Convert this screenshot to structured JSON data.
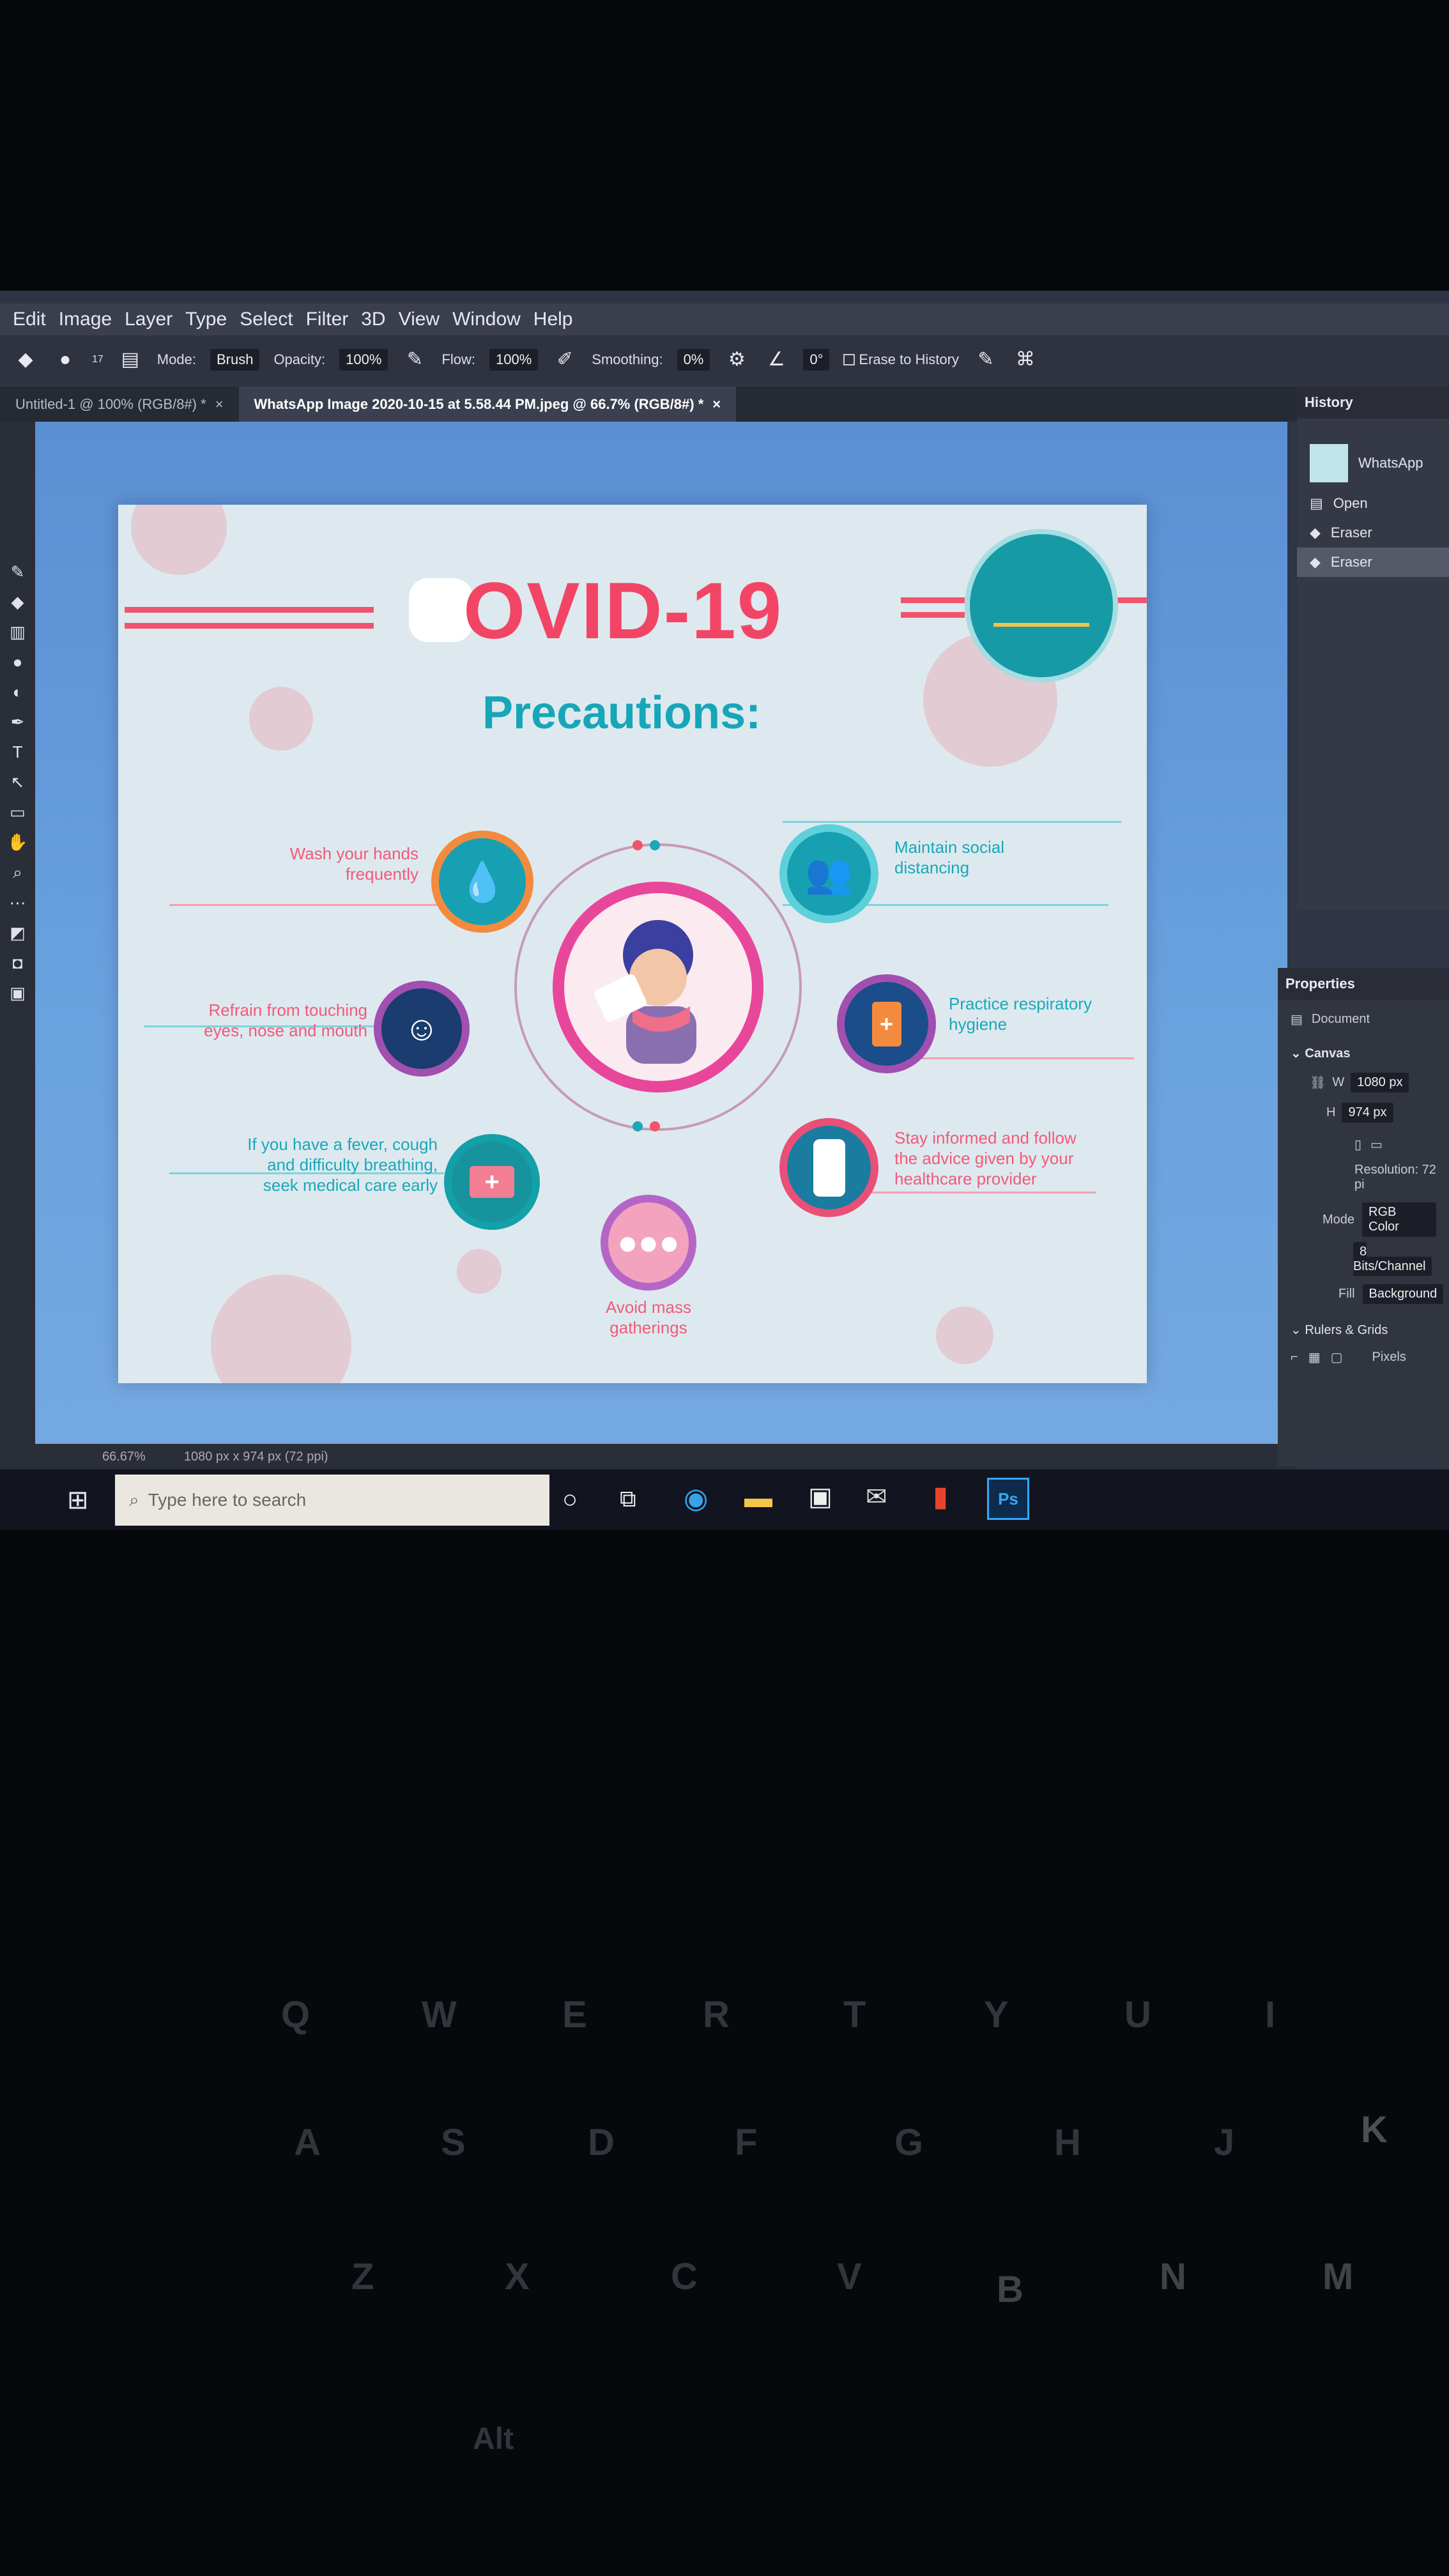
{
  "menu": [
    "Edit",
    "Image",
    "Layer",
    "Type",
    "Select",
    "Filter",
    "3D",
    "View",
    "Window",
    "Help"
  ],
  "options": {
    "mode_label": "Mode:",
    "mode_value": "Brush",
    "opacity_label": "Opacity:",
    "opacity_value": "100%",
    "flow_label": "Flow:",
    "flow_value": "100%",
    "smoothing_label": "Smoothing:",
    "smoothing_value": "0%",
    "angle_value": "0°",
    "erase_history": "Erase to History",
    "brush_size": "17"
  },
  "tabs": [
    {
      "label": "Untitled-1 @ 100% (RGB/8#) *"
    },
    {
      "label": "WhatsApp Image 2020-10-15 at 5.58.44 PM.jpeg @ 66.7% (RGB/8#) *"
    }
  ],
  "poster": {
    "title": "OVID-19",
    "subtitle": "Precautions:",
    "tips_left": [
      {
        "text": "Wash your hands\nfrequently"
      },
      {
        "text": "Refrain from touching\neyes, nose and mouth"
      },
      {
        "text": "If you have a fever, cough\nand difficulty breathing,\nseek medical care early"
      }
    ],
    "tips_right": [
      {
        "text": "Maintain social\ndistancing"
      },
      {
        "text": "Practice respiratory\nhygiene"
      },
      {
        "text": "Stay informed and follow\nthe advice given by your\nhealthcare provider"
      }
    ],
    "tip_bottom": "Avoid mass\ngatherings"
  },
  "history": {
    "title": "History",
    "snapshot": "WhatsApp",
    "items": [
      {
        "label": "Open"
      },
      {
        "label": "Eraser"
      },
      {
        "label": "Eraser"
      }
    ]
  },
  "properties": {
    "title": "Properties",
    "document": "Document",
    "canvas": "Canvas",
    "w_label": "W",
    "w_value": "1080 px",
    "h_label": "H",
    "h_value": "974 px",
    "resolution": "Resolution: 72 pi",
    "mode_label": "Mode",
    "mode_value": "RGB Color",
    "bits": "8 Bits/Channel",
    "fill_label": "Fill",
    "fill_value": "Background",
    "rulers": "Rulers & Grids",
    "pixels": "Pixels"
  },
  "status": {
    "zoom": "66.67%",
    "size": "1080 px x 974 px (72 ppi)"
  },
  "taskbar": {
    "search_placeholder": "Type here to search",
    "ps_label": "Ps"
  },
  "keyboard": {
    "row1": [
      "Q",
      "W",
      "E",
      "R",
      "T",
      "Y",
      "U",
      "I"
    ],
    "row2": [
      "A",
      "S",
      "D",
      "F",
      "G",
      "H",
      "J",
      "K"
    ],
    "row3": [
      "Z",
      "X",
      "C",
      "V",
      "B",
      "N",
      "M"
    ],
    "alt": "Alt"
  }
}
